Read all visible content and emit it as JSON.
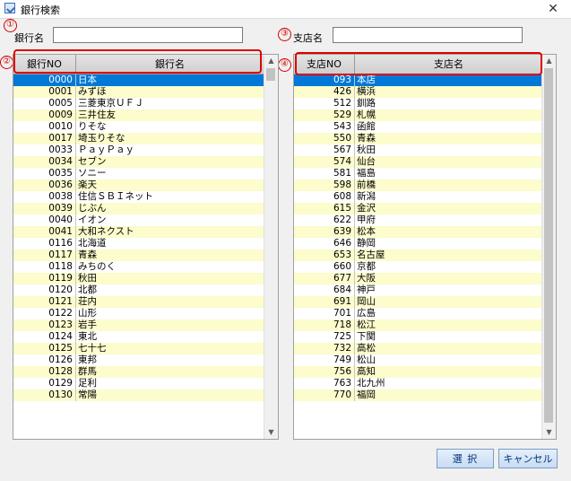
{
  "window": {
    "title": "銀行検索"
  },
  "markers": [
    "①",
    "②",
    "③",
    "④"
  ],
  "bank_search": {
    "label": "銀行名",
    "value": ""
  },
  "branch_search": {
    "label": "支店名",
    "value": ""
  },
  "bank_grid": {
    "headers": [
      "銀行NO",
      "銀行名"
    ],
    "rows": [
      [
        "0000",
        "日本"
      ],
      [
        "0001",
        "みずほ"
      ],
      [
        "0005",
        "三菱東京ＵＦＪ"
      ],
      [
        "0009",
        "三井住友"
      ],
      [
        "0010",
        "りそな"
      ],
      [
        "0017",
        "埼玉りそな"
      ],
      [
        "0033",
        "ＰａｙＰａｙ"
      ],
      [
        "0034",
        "セブン"
      ],
      [
        "0035",
        "ソニー"
      ],
      [
        "0036",
        "楽天"
      ],
      [
        "0038",
        "住信ＳＢＩネット"
      ],
      [
        "0039",
        "じぶん"
      ],
      [
        "0040",
        "イオン"
      ],
      [
        "0041",
        "大和ネクスト"
      ],
      [
        "0116",
        "北海道"
      ],
      [
        "0117",
        "青森"
      ],
      [
        "0118",
        "みちのく"
      ],
      [
        "0119",
        "秋田"
      ],
      [
        "0120",
        "北都"
      ],
      [
        "0121",
        "荘内"
      ],
      [
        "0122",
        "山形"
      ],
      [
        "0123",
        "岩手"
      ],
      [
        "0124",
        "東北"
      ],
      [
        "0125",
        "七十七"
      ],
      [
        "0126",
        "東邦"
      ],
      [
        "0128",
        "群馬"
      ],
      [
        "0129",
        "足利"
      ],
      [
        "0130",
        "常陽"
      ]
    ]
  },
  "branch_grid": {
    "headers": [
      "支店NO",
      "支店名"
    ],
    "rows": [
      [
        "093",
        "本店"
      ],
      [
        "426",
        "横浜"
      ],
      [
        "512",
        "釧路"
      ],
      [
        "529",
        "札幌"
      ],
      [
        "543",
        "函館"
      ],
      [
        "550",
        "青森"
      ],
      [
        "567",
        "秋田"
      ],
      [
        "574",
        "仙台"
      ],
      [
        "581",
        "福島"
      ],
      [
        "598",
        "前橋"
      ],
      [
        "608",
        "新潟"
      ],
      [
        "615",
        "金沢"
      ],
      [
        "622",
        "甲府"
      ],
      [
        "639",
        "松本"
      ],
      [
        "646",
        "静岡"
      ],
      [
        "653",
        "名古屋"
      ],
      [
        "660",
        "京都"
      ],
      [
        "677",
        "大阪"
      ],
      [
        "684",
        "神戸"
      ],
      [
        "691",
        "岡山"
      ],
      [
        "701",
        "広島"
      ],
      [
        "718",
        "松江"
      ],
      [
        "725",
        "下関"
      ],
      [
        "732",
        "高松"
      ],
      [
        "749",
        "松山"
      ],
      [
        "756",
        "高知"
      ],
      [
        "763",
        "北九州"
      ],
      [
        "770",
        "福岡"
      ]
    ]
  },
  "buttons": {
    "select": "選 択",
    "cancel": "キャンセル"
  },
  "colors": {
    "selected_row": "#0078d7",
    "alt_row": "#fcfccc",
    "marker": "#d40000"
  }
}
